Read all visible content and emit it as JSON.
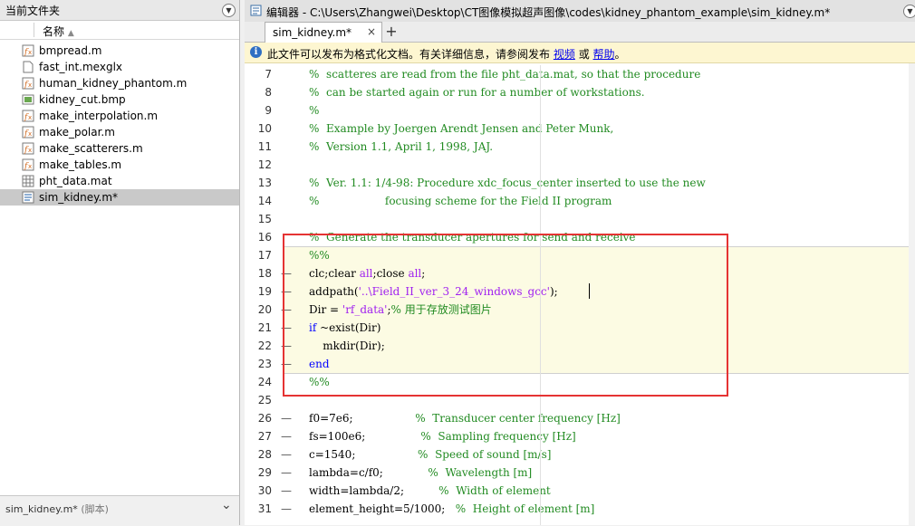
{
  "left_panel": {
    "title": "当前文件夹",
    "column_name": "名称",
    "files": [
      {
        "name": "bmpread.m",
        "icon": "mfile-function-icon",
        "selected": false
      },
      {
        "name": "fast_int.mexglx",
        "icon": "file-icon",
        "selected": false
      },
      {
        "name": "human_kidney_phantom.m",
        "icon": "mfile-function-icon",
        "selected": false
      },
      {
        "name": "kidney_cut.bmp",
        "icon": "image-file-icon",
        "selected": false
      },
      {
        "name": "make_interpolation.m",
        "icon": "mfile-function-icon",
        "selected": false
      },
      {
        "name": "make_polar.m",
        "icon": "mfile-function-icon",
        "selected": false
      },
      {
        "name": "make_scatterers.m",
        "icon": "mfile-function-icon",
        "selected": false
      },
      {
        "name": "make_tables.m",
        "icon": "mfile-function-icon",
        "selected": false
      },
      {
        "name": "pht_data.mat",
        "icon": "mat-file-icon",
        "selected": false
      },
      {
        "name": "sim_kidney.m*",
        "icon": "mfile-script-icon",
        "selected": true
      }
    ],
    "footer_name": "sim_kidney.m*",
    "footer_sub": "(脚本)"
  },
  "editor": {
    "title": "编辑器 - C:\\Users\\Zhangwei\\Desktop\\CT图像模拟超声图像\\codes\\kidney_phantom_example\\sim_kidney.m*",
    "tab_label": "sim_kidney.m*",
    "tab_close": "×",
    "add_tab": "+",
    "info_text": "此文件可以发布为格式化文档。有关详细信息，请参阅发布",
    "info_link_video": "视频",
    "info_or": "或",
    "info_link_help": "帮助",
    "info_end": "。"
  },
  "code_lines": [
    {
      "n": "7",
      "mark": "",
      "segs": [
        {
          "c": "cm",
          "t": "%  scatteres are read from the file pht_data.mat, so that the procedure"
        }
      ]
    },
    {
      "n": "8",
      "mark": "",
      "segs": [
        {
          "c": "cm",
          "t": "%  can be started again or run for a number of workstations."
        }
      ]
    },
    {
      "n": "9",
      "mark": "",
      "segs": [
        {
          "c": "cm",
          "t": "%"
        }
      ]
    },
    {
      "n": "10",
      "mark": "",
      "segs": [
        {
          "c": "cm",
          "t": "%  Example by Joergen Arendt Jensen and Peter Munk,"
        }
      ]
    },
    {
      "n": "11",
      "mark": "",
      "segs": [
        {
          "c": "cm",
          "t": "%  Version 1.1, April 1, 1998, JAJ."
        }
      ]
    },
    {
      "n": "12",
      "mark": "",
      "segs": []
    },
    {
      "n": "13",
      "mark": "",
      "segs": [
        {
          "c": "cm",
          "t": "%  Ver. 1.1: 1/4-98: Procedure xdc_focus_center inserted to use the new"
        }
      ]
    },
    {
      "n": "14",
      "mark": "",
      "segs": [
        {
          "c": "cm",
          "t": "%                   focusing scheme for the Field II program"
        }
      ]
    },
    {
      "n": "15",
      "mark": "",
      "segs": []
    },
    {
      "n": "16",
      "mark": "",
      "segs": [
        {
          "c": "cm",
          "t": "%  Generate the transducer apertures for send and receive"
        }
      ]
    },
    {
      "n": "17",
      "mark": "",
      "segs": [
        {
          "c": "cm",
          "t": "%%"
        }
      ]
    },
    {
      "n": "18",
      "mark": "—",
      "segs": [
        {
          "c": "",
          "t": "clc;clear "
        },
        {
          "c": "st",
          "t": "all"
        },
        {
          "c": "",
          "t": ";close "
        },
        {
          "c": "st",
          "t": "all"
        },
        {
          "c": "",
          "t": ";"
        }
      ]
    },
    {
      "n": "19",
      "mark": "—",
      "segs": [
        {
          "c": "",
          "t": "addpath("
        },
        {
          "c": "st",
          "t": "'..\\Field_II_ver_3_24_windows_gcc'"
        },
        {
          "c": "",
          "t": ");"
        }
      ]
    },
    {
      "n": "20",
      "mark": "—",
      "segs": [
        {
          "c": "",
          "t": "Dir = "
        },
        {
          "c": "st",
          "t": "'rf_data'"
        },
        {
          "c": "",
          "t": ";"
        },
        {
          "c": "cm",
          "t": "% 用于存放测试图片"
        }
      ]
    },
    {
      "n": "21",
      "mark": "—",
      "segs": [
        {
          "c": "kw",
          "t": "if "
        },
        {
          "c": "",
          "t": "~exist(Dir)"
        }
      ]
    },
    {
      "n": "22",
      "mark": "—",
      "segs": [
        {
          "c": "",
          "t": "    mkdir(Dir);"
        }
      ]
    },
    {
      "n": "23",
      "mark": "—",
      "segs": [
        {
          "c": "kw",
          "t": "end"
        }
      ]
    },
    {
      "n": "24",
      "mark": "",
      "segs": [
        {
          "c": "cm",
          "t": "%%"
        }
      ]
    },
    {
      "n": "25",
      "mark": "",
      "segs": []
    },
    {
      "n": "26",
      "mark": "—",
      "segs": [
        {
          "c": "",
          "t": "f0=7e6;                  "
        },
        {
          "c": "cm",
          "t": "%  Transducer center frequency [Hz]"
        }
      ]
    },
    {
      "n": "27",
      "mark": "—",
      "segs": [
        {
          "c": "",
          "t": "fs=100e6;                "
        },
        {
          "c": "cm",
          "t": "%  Sampling frequency [Hz]"
        }
      ]
    },
    {
      "n": "28",
      "mark": "—",
      "segs": [
        {
          "c": "",
          "t": "c=1540;                  "
        },
        {
          "c": "cm",
          "t": "%  Speed of sound [m/s]"
        }
      ]
    },
    {
      "n": "29",
      "mark": "—",
      "segs": [
        {
          "c": "",
          "t": "lambda=c/f0;             "
        },
        {
          "c": "cm",
          "t": "%  Wavelength [m]"
        }
      ]
    },
    {
      "n": "30",
      "mark": "—",
      "segs": [
        {
          "c": "",
          "t": "width=lambda/2;          "
        },
        {
          "c": "cm",
          "t": "%  Width of element"
        }
      ]
    },
    {
      "n": "31",
      "mark": "—",
      "segs": [
        {
          "c": "",
          "t": "element_height=5/1000;   "
        },
        {
          "c": "cm",
          "t": "%  Height of element [m]"
        }
      ]
    }
  ]
}
